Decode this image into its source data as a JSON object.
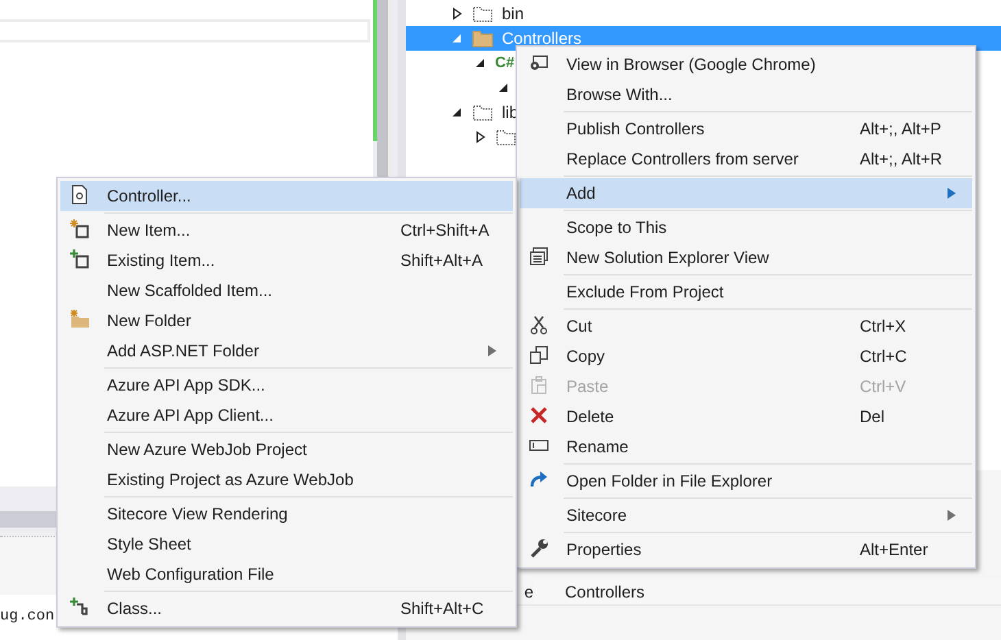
{
  "editor": {
    "output_line": "ug.con"
  },
  "solution_explorer": {
    "tree": [
      {
        "kind": "excluded-folder",
        "label": "bin",
        "expanded": false,
        "selected": false
      },
      {
        "kind": "folder",
        "label": "Controllers",
        "expanded": true,
        "selected": true,
        "children": [
          {
            "kind": "file",
            "icon_text": "C#",
            "expanded": true,
            "selected": false,
            "children": [
              {
                "expanded": true,
                "selected": false
              }
            ]
          }
        ]
      },
      {
        "kind": "excluded-folder",
        "label": "lib",
        "expanded": true,
        "selected": false,
        "children": [
          {
            "kind": "excluded-folder",
            "expanded": false,
            "selected": false
          }
        ]
      }
    ]
  },
  "properties": {
    "rows": [
      {
        "name": "e",
        "value": "Controllers"
      }
    ]
  },
  "context_menus": [
    {
      "items": [
        {
          "kind": "item",
          "label": "View in Browser (Google Chrome)",
          "selected": false,
          "disabled": false
        },
        {
          "kind": "item",
          "label": "Browse With...",
          "selected": false,
          "disabled": false
        },
        {
          "kind": "separator"
        },
        {
          "kind": "item",
          "label": "Publish Controllers",
          "shortcut": "Alt+;, Alt+P",
          "selected": false,
          "disabled": false
        },
        {
          "kind": "item",
          "label": "Replace Controllers from server",
          "shortcut": "Alt+;, Alt+R",
          "selected": false,
          "disabled": false
        },
        {
          "kind": "separator"
        },
        {
          "kind": "item",
          "label": "Add",
          "submenu": true,
          "selected": true,
          "disabled": false
        },
        {
          "kind": "separator"
        },
        {
          "kind": "item",
          "label": "Scope to This",
          "selected": false,
          "disabled": false
        },
        {
          "kind": "item",
          "label": "New Solution Explorer View",
          "selected": false,
          "disabled": false
        },
        {
          "kind": "separator"
        },
        {
          "kind": "item",
          "label": "Exclude From Project",
          "selected": false,
          "disabled": false
        },
        {
          "kind": "separator"
        },
        {
          "kind": "item",
          "label": "Cut",
          "shortcut": "Ctrl+X",
          "selected": false,
          "disabled": false
        },
        {
          "kind": "item",
          "label": "Copy",
          "shortcut": "Ctrl+C",
          "selected": false,
          "disabled": false
        },
        {
          "kind": "item",
          "label": "Paste",
          "shortcut": "Ctrl+V",
          "selected": false,
          "disabled": true
        },
        {
          "kind": "item",
          "label": "Delete",
          "shortcut": "Del",
          "selected": false,
          "disabled": false
        },
        {
          "kind": "item",
          "label": "Rename",
          "selected": false,
          "disabled": false
        },
        {
          "kind": "separator"
        },
        {
          "kind": "item",
          "label": "Open Folder in File Explorer",
          "selected": false,
          "disabled": false
        },
        {
          "kind": "separator"
        },
        {
          "kind": "item",
          "label": "Sitecore",
          "submenu": true,
          "selected": false,
          "disabled": false
        },
        {
          "kind": "separator"
        },
        {
          "kind": "item",
          "label": "Properties",
          "shortcut": "Alt+Enter",
          "selected": false,
          "disabled": false
        }
      ]
    },
    {
      "items": [
        {
          "kind": "item",
          "label": "Controller...",
          "selected": true,
          "disabled": false
        },
        {
          "kind": "separator"
        },
        {
          "kind": "item",
          "label": "New Item...",
          "shortcut": "Ctrl+Shift+A",
          "selected": false,
          "disabled": false
        },
        {
          "kind": "item",
          "label": "Existing Item...",
          "shortcut": "Shift+Alt+A",
          "selected": false,
          "disabled": false
        },
        {
          "kind": "item",
          "label": "New Scaffolded Item...",
          "selected": false,
          "disabled": false
        },
        {
          "kind": "item",
          "label": "New Folder",
          "selected": false,
          "disabled": false
        },
        {
          "kind": "item",
          "label": "Add ASP.NET Folder",
          "submenu": true,
          "selected": false,
          "disabled": false
        },
        {
          "kind": "separator"
        },
        {
          "kind": "item",
          "label": "Azure API App SDK...",
          "selected": false,
          "disabled": false
        },
        {
          "kind": "item",
          "label": "Azure API App Client...",
          "selected": false,
          "disabled": false
        },
        {
          "kind": "separator"
        },
        {
          "kind": "item",
          "label": "New Azure WebJob Project",
          "selected": false,
          "disabled": false
        },
        {
          "kind": "item",
          "label": "Existing Project as Azure WebJob",
          "selected": false,
          "disabled": false
        },
        {
          "kind": "separator"
        },
        {
          "kind": "item",
          "label": "Sitecore View Rendering",
          "selected": false,
          "disabled": false
        },
        {
          "kind": "item",
          "label": "Style Sheet",
          "selected": false,
          "disabled": false
        },
        {
          "kind": "item",
          "label": "Web Configuration File",
          "selected": false,
          "disabled": false
        },
        {
          "kind": "separator"
        },
        {
          "kind": "item",
          "label": "Class...",
          "shortcut": "Shift+Alt+C",
          "selected": false,
          "disabled": false
        }
      ]
    }
  ]
}
